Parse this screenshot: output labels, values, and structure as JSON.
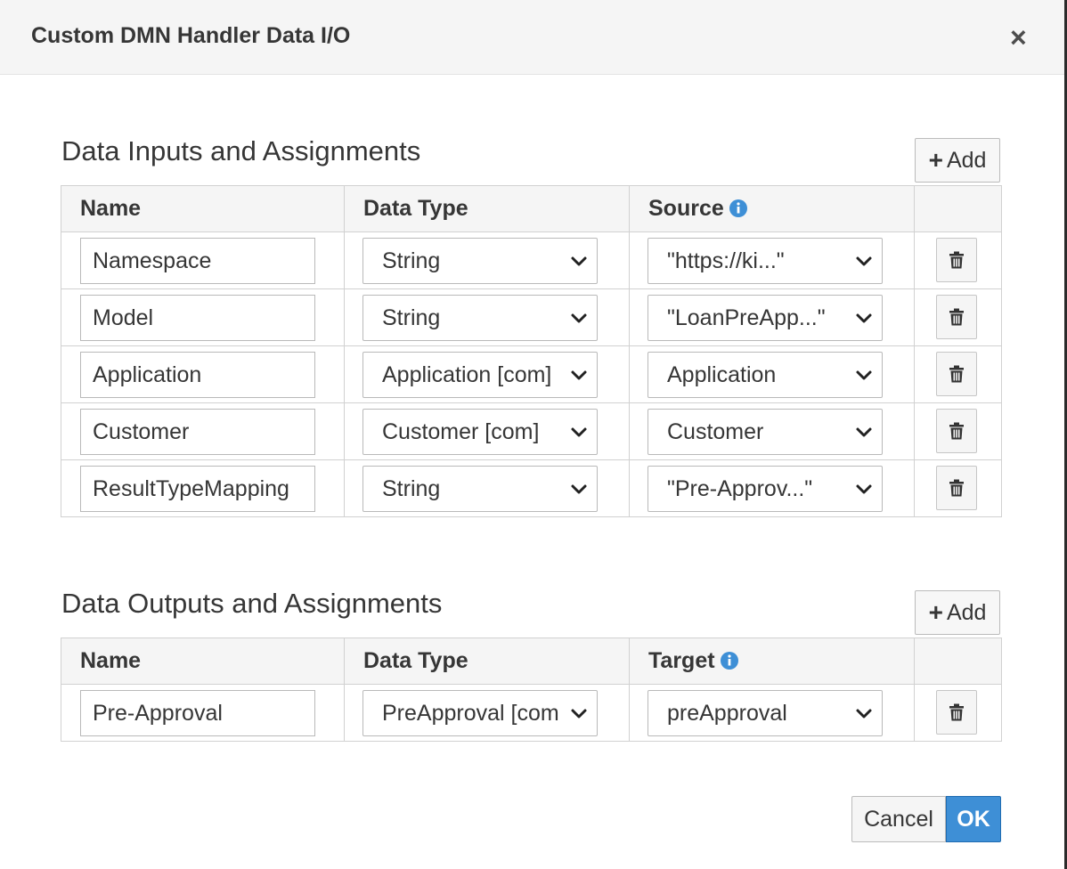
{
  "dialog": {
    "title": "Custom DMN Handler Data I/O",
    "close_label": "×"
  },
  "inputs": {
    "section_title": "Data Inputs and Assignments",
    "add_label": "Add",
    "headers": {
      "name": "Name",
      "data_type": "Data Type",
      "source": "Source"
    },
    "rows": [
      {
        "name": "Namespace",
        "data_type": "String",
        "source": "\"https://ki...\""
      },
      {
        "name": "Model",
        "data_type": "String",
        "source": "\"LoanPreApp...\""
      },
      {
        "name": "Application",
        "data_type": "Application [com]",
        "source": "Application"
      },
      {
        "name": "Customer",
        "data_type": "Customer [com]",
        "source": "Customer"
      },
      {
        "name": "ResultTypeMapping",
        "data_type": "String",
        "source": "\"Pre-Approv...\""
      }
    ]
  },
  "outputs": {
    "section_title": "Data Outputs and Assignments",
    "add_label": "Add",
    "headers": {
      "name": "Name",
      "data_type": "Data Type",
      "target": "Target"
    },
    "rows": [
      {
        "name": "Pre-Approval",
        "data_type": "PreApproval [com",
        "target": "preApproval"
      }
    ]
  },
  "footer": {
    "cancel_label": "Cancel",
    "ok_label": "OK"
  },
  "icons": {
    "close": "close-icon",
    "add": "plus-icon",
    "info": "info-circle-icon",
    "dropdown": "chevron-down-icon",
    "delete": "trash-icon"
  },
  "colors": {
    "primary": "#3e8fd6",
    "info": "#3e8fd6",
    "header_bg": "#f5f5f5"
  }
}
